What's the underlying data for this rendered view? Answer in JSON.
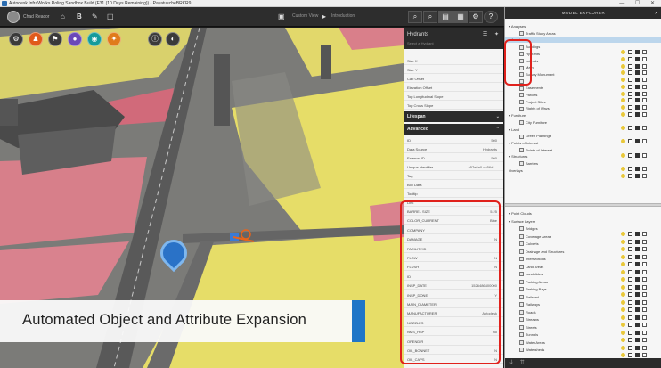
{
  "window": {
    "title": "Autodesk InfraWorks Roling Sandbox Build (F31 (10 Days Remaining)) - PayatuscheBRKR9",
    "controls": "— ☐ ✕"
  },
  "topbar": {
    "username": "Chad Reacor",
    "center_tabs": [
      "Custom View",
      "Introduction"
    ]
  },
  "properties_panel": {
    "title": "Hydrants",
    "subtitle": "Select a Hydrant",
    "rows_top": [
      {
        "label": "Size X",
        "value": ""
      },
      {
        "label": "Size Y",
        "value": ""
      },
      {
        "label": "Cap Offset",
        "value": ""
      },
      {
        "label": "Elevation Offset",
        "value": ""
      },
      {
        "label": "Top Longitudinal Slope",
        "value": ""
      },
      {
        "label": "Top Cross Slope",
        "value": ""
      }
    ],
    "section_lifespan": "Lifespan",
    "section_advanced": "Advanced",
    "rows_advanced": [
      {
        "label": "ID",
        "value": "500"
      },
      {
        "label": "Data Source",
        "value": "Hydrants"
      },
      {
        "label": "External ID",
        "value": "500"
      },
      {
        "label": "Unique Identifier",
        "value": "a57e8a0-ca56d-..."
      },
      {
        "label": "Tag",
        "value": ""
      },
      {
        "label": "Box Data",
        "value": ""
      },
      {
        "label": "Tooltip",
        "value": ""
      },
      {
        "label": "Link",
        "value": ""
      }
    ],
    "rows_attributes": [
      {
        "label": "BARREL SIZE",
        "value": "5.25"
      },
      {
        "label": "COLOR_CURRENT",
        "value": "Blue"
      },
      {
        "label": "COMPANY",
        "value": ""
      },
      {
        "label": "DAMAGE",
        "value": "N"
      },
      {
        "label": "FACILITYID",
        "value": ""
      },
      {
        "label": "FLOW",
        "value": "N"
      },
      {
        "label": "FLUSH",
        "value": "N"
      },
      {
        "label": "ID",
        "value": ""
      },
      {
        "label": "INSP_DATE",
        "value": "1526486400000"
      },
      {
        "label": "INSP_DONE",
        "value": "Y"
      },
      {
        "label": "MAIN_DIAMETER",
        "value": ""
      },
      {
        "label": "MANUFACTURER",
        "value": "Autodesk"
      },
      {
        "label": "NOZZLES",
        "value": ""
      },
      {
        "label": "NMS_HSP",
        "value": "No"
      },
      {
        "label": "OPENDIR",
        "value": ""
      },
      {
        "label": "OIL_BONNET",
        "value": "N"
      },
      {
        "label": "OIL_CAPS",
        "value": "N"
      }
    ]
  },
  "explorer": {
    "title": "MODEL EXPLORER",
    "tree": [
      {
        "label": "Analyses",
        "level": 0,
        "group": true
      },
      {
        "label": "Traffic Study Areas",
        "level": 1
      },
      {
        "label": "Assets",
        "level": 0,
        "group": true,
        "selected": true
      },
      {
        "label": "Buildings",
        "level": 1
      },
      {
        "label": "Hydrants",
        "level": 1
      },
      {
        "label": "Laterals",
        "level": 1
      },
      {
        "label": "Main",
        "level": 1
      },
      {
        "label": "Survey Monument",
        "level": 1
      },
      {
        "label": "",
        "level": 1
      },
      {
        "label": "Easements",
        "level": 1
      },
      {
        "label": "Parcels",
        "level": 1
      },
      {
        "label": "Project Sites",
        "level": 1
      },
      {
        "label": "Rights of Ways",
        "level": 1
      },
      {
        "label": "Furniture",
        "level": 0,
        "group": true
      },
      {
        "label": "City Furniture",
        "level": 1
      },
      {
        "label": "Land",
        "level": 0,
        "group": true
      },
      {
        "label": "Green Plantings",
        "level": 1
      },
      {
        "label": "Points of Interest",
        "level": 0,
        "group": true
      },
      {
        "label": "Points of Interest",
        "level": 1
      },
      {
        "label": "Structures",
        "level": 0,
        "group": true
      },
      {
        "label": "Barriers",
        "level": 1
      },
      {
        "label": "Overlays",
        "level": 0,
        "group": false
      }
    ],
    "tree2": [
      {
        "label": "Point Clouds",
        "level": 0,
        "group": true
      },
      {
        "label": "Surface Layers",
        "level": 0,
        "group": true
      },
      {
        "label": "Bridges",
        "level": 1
      },
      {
        "label": "Coverage Areas",
        "level": 1
      },
      {
        "label": "Culverts",
        "level": 1
      },
      {
        "label": "Drainage and Structures",
        "level": 1
      },
      {
        "label": "Intersections",
        "level": 1
      },
      {
        "label": "Land Areas",
        "level": 1
      },
      {
        "label": "Landslides",
        "level": 1
      },
      {
        "label": "Parking Areas",
        "level": 1
      },
      {
        "label": "Parking Bays",
        "level": 1
      },
      {
        "label": "Railroad",
        "level": 1
      },
      {
        "label": "Railways",
        "level": 1
      },
      {
        "label": "Roads",
        "level": 1
      },
      {
        "label": "Streams",
        "level": 1
      },
      {
        "label": "Streets",
        "level": 1
      },
      {
        "label": "Tunnels",
        "level": 1
      },
      {
        "label": "Water Areas",
        "level": 1
      },
      {
        "label": "Watersheds",
        "level": 1
      }
    ]
  },
  "caption": {
    "text": "Automated Object and Attribute Expansion"
  },
  "colors": {
    "yellow_zone": "#e8df62",
    "red_zone": "#d9788a",
    "accent_blue": "#1f76c7",
    "highlight_red": "#e0211c"
  }
}
